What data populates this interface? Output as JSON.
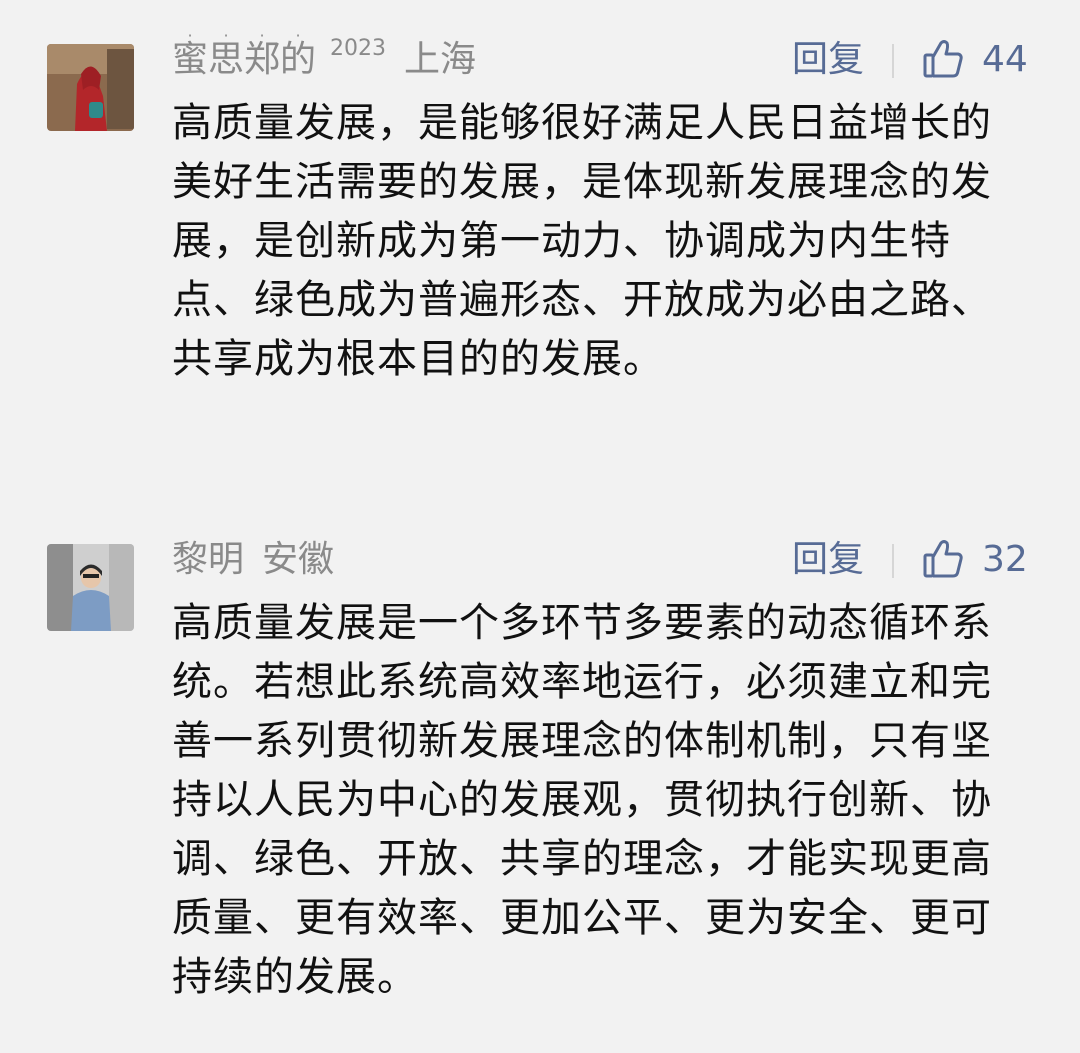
{
  "comments": [
    {
      "user": "蜜思郑的",
      "badge": "2023",
      "location": "上海",
      "reply_label": "回复",
      "likes": "44",
      "text": "高质量发展，是能够很好满足人民日益增长的美好生活需要的发展，是体现新发展理念的发展，是创新成为第一动力、协调成为内生特点、绿色成为普遍形态、开放成为必由之路、共享成为根本目的的发展。"
    },
    {
      "user": "黎明",
      "location": "安徽",
      "reply_label": "回复",
      "likes": "32",
      "text": "高质量发展是一个多环节多要素的动态循环系统。若想此系统高效率地运行，必须建立和完善一系列贯彻新发展理念的体制机制，只有坚持以人民为中心的发展观，贯彻执行创新、协调、绿色、开放、共享的理念，才能实现更高质量、更有效率、更加公平、更为安全、更可持续的发展。"
    }
  ],
  "icons": {
    "like": "thumbs-up-icon"
  },
  "colors": {
    "link": "#576b95",
    "meta": "#8a8a8a",
    "background": "#f2f2f2"
  }
}
